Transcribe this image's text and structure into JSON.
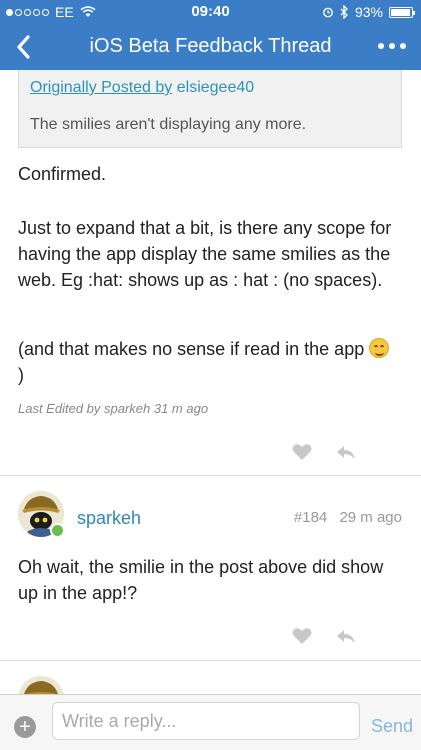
{
  "status": {
    "carrier": "EE",
    "time": "09:40",
    "battery": "93%",
    "battery_level": 0.93
  },
  "nav": {
    "title": "iOS Beta Feedback Thread",
    "back_icon": "chevron-left-icon",
    "more_icon": "more-dots-icon"
  },
  "quote": {
    "attribution_prefix": "Originally Posted by",
    "author": "elsiegee40",
    "text": "The smilies aren't displaying any more."
  },
  "post1": {
    "para1": "Confirmed.",
    "para2": "Just to expand that a bit, is there any scope for having the app display the same smilies as the web. Eg :hat: shows up as : hat : (no spaces).",
    "para3": "(and that makes no sense if read in the app",
    "para3_end": ")",
    "edited": "Last Edited by sparkeh 31 m ago"
  },
  "post2": {
    "username": "sparkeh",
    "number": "#184",
    "time": "29 m ago",
    "text": "Oh wait, the smilie in the post above did show up in the app!?"
  },
  "reply": {
    "placeholder": "Write a reply...",
    "send_label": "Send",
    "add_icon": "plus-icon"
  },
  "colors": {
    "brand": "#3b7ec7",
    "link": "#2b8bb5",
    "send": "#88b5de"
  }
}
